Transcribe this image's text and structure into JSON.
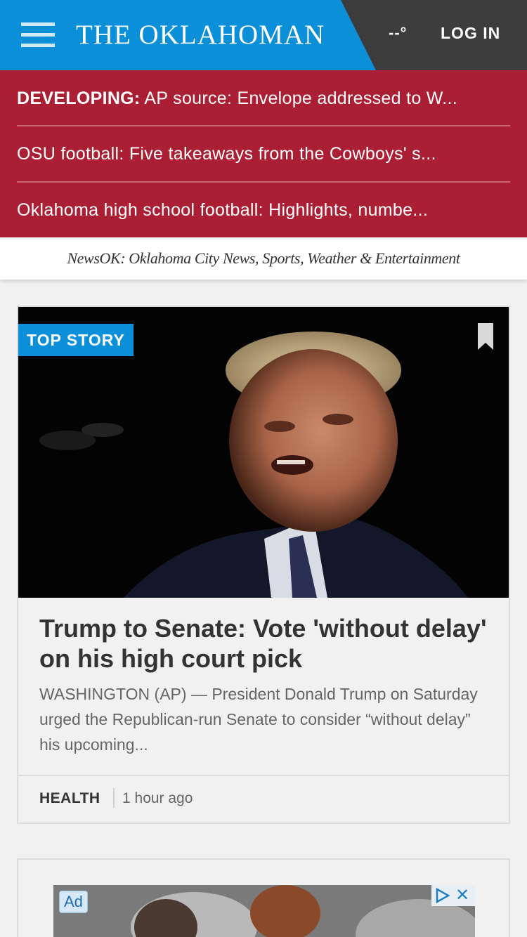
{
  "header": {
    "title": "THE OKLAHOMAN",
    "weather": "--°",
    "login_label": "LOG IN"
  },
  "breaking": [
    {
      "prefix": "DEVELOPING:",
      "text": " AP source: Envelope addressed to W..."
    },
    {
      "prefix": "",
      "text": "OSU football: Five takeaways from the Cowboys' s..."
    },
    {
      "prefix": "",
      "text": "Oklahoma high school football: Highlights, numbe..."
    }
  ],
  "tagline": "NewsOK: Oklahoma City News, Sports, Weather & Entertainment",
  "story": {
    "badge": "TOP STORY",
    "headline": "Trump to Senate: Vote 'without delay' on his high court pick",
    "summary": "WASHINGTON (AP) — President Donald Trump on Saturday urged the Republican-run Senate to consider “without delay” his upcoming...",
    "section": "HEALTH",
    "time": "1 hour ago"
  },
  "ad": {
    "label": "Ad"
  },
  "colors": {
    "header_blue": "#0a8fd8",
    "header_dark": "#3d3d3d",
    "breaking_red": "#ab1f34"
  }
}
